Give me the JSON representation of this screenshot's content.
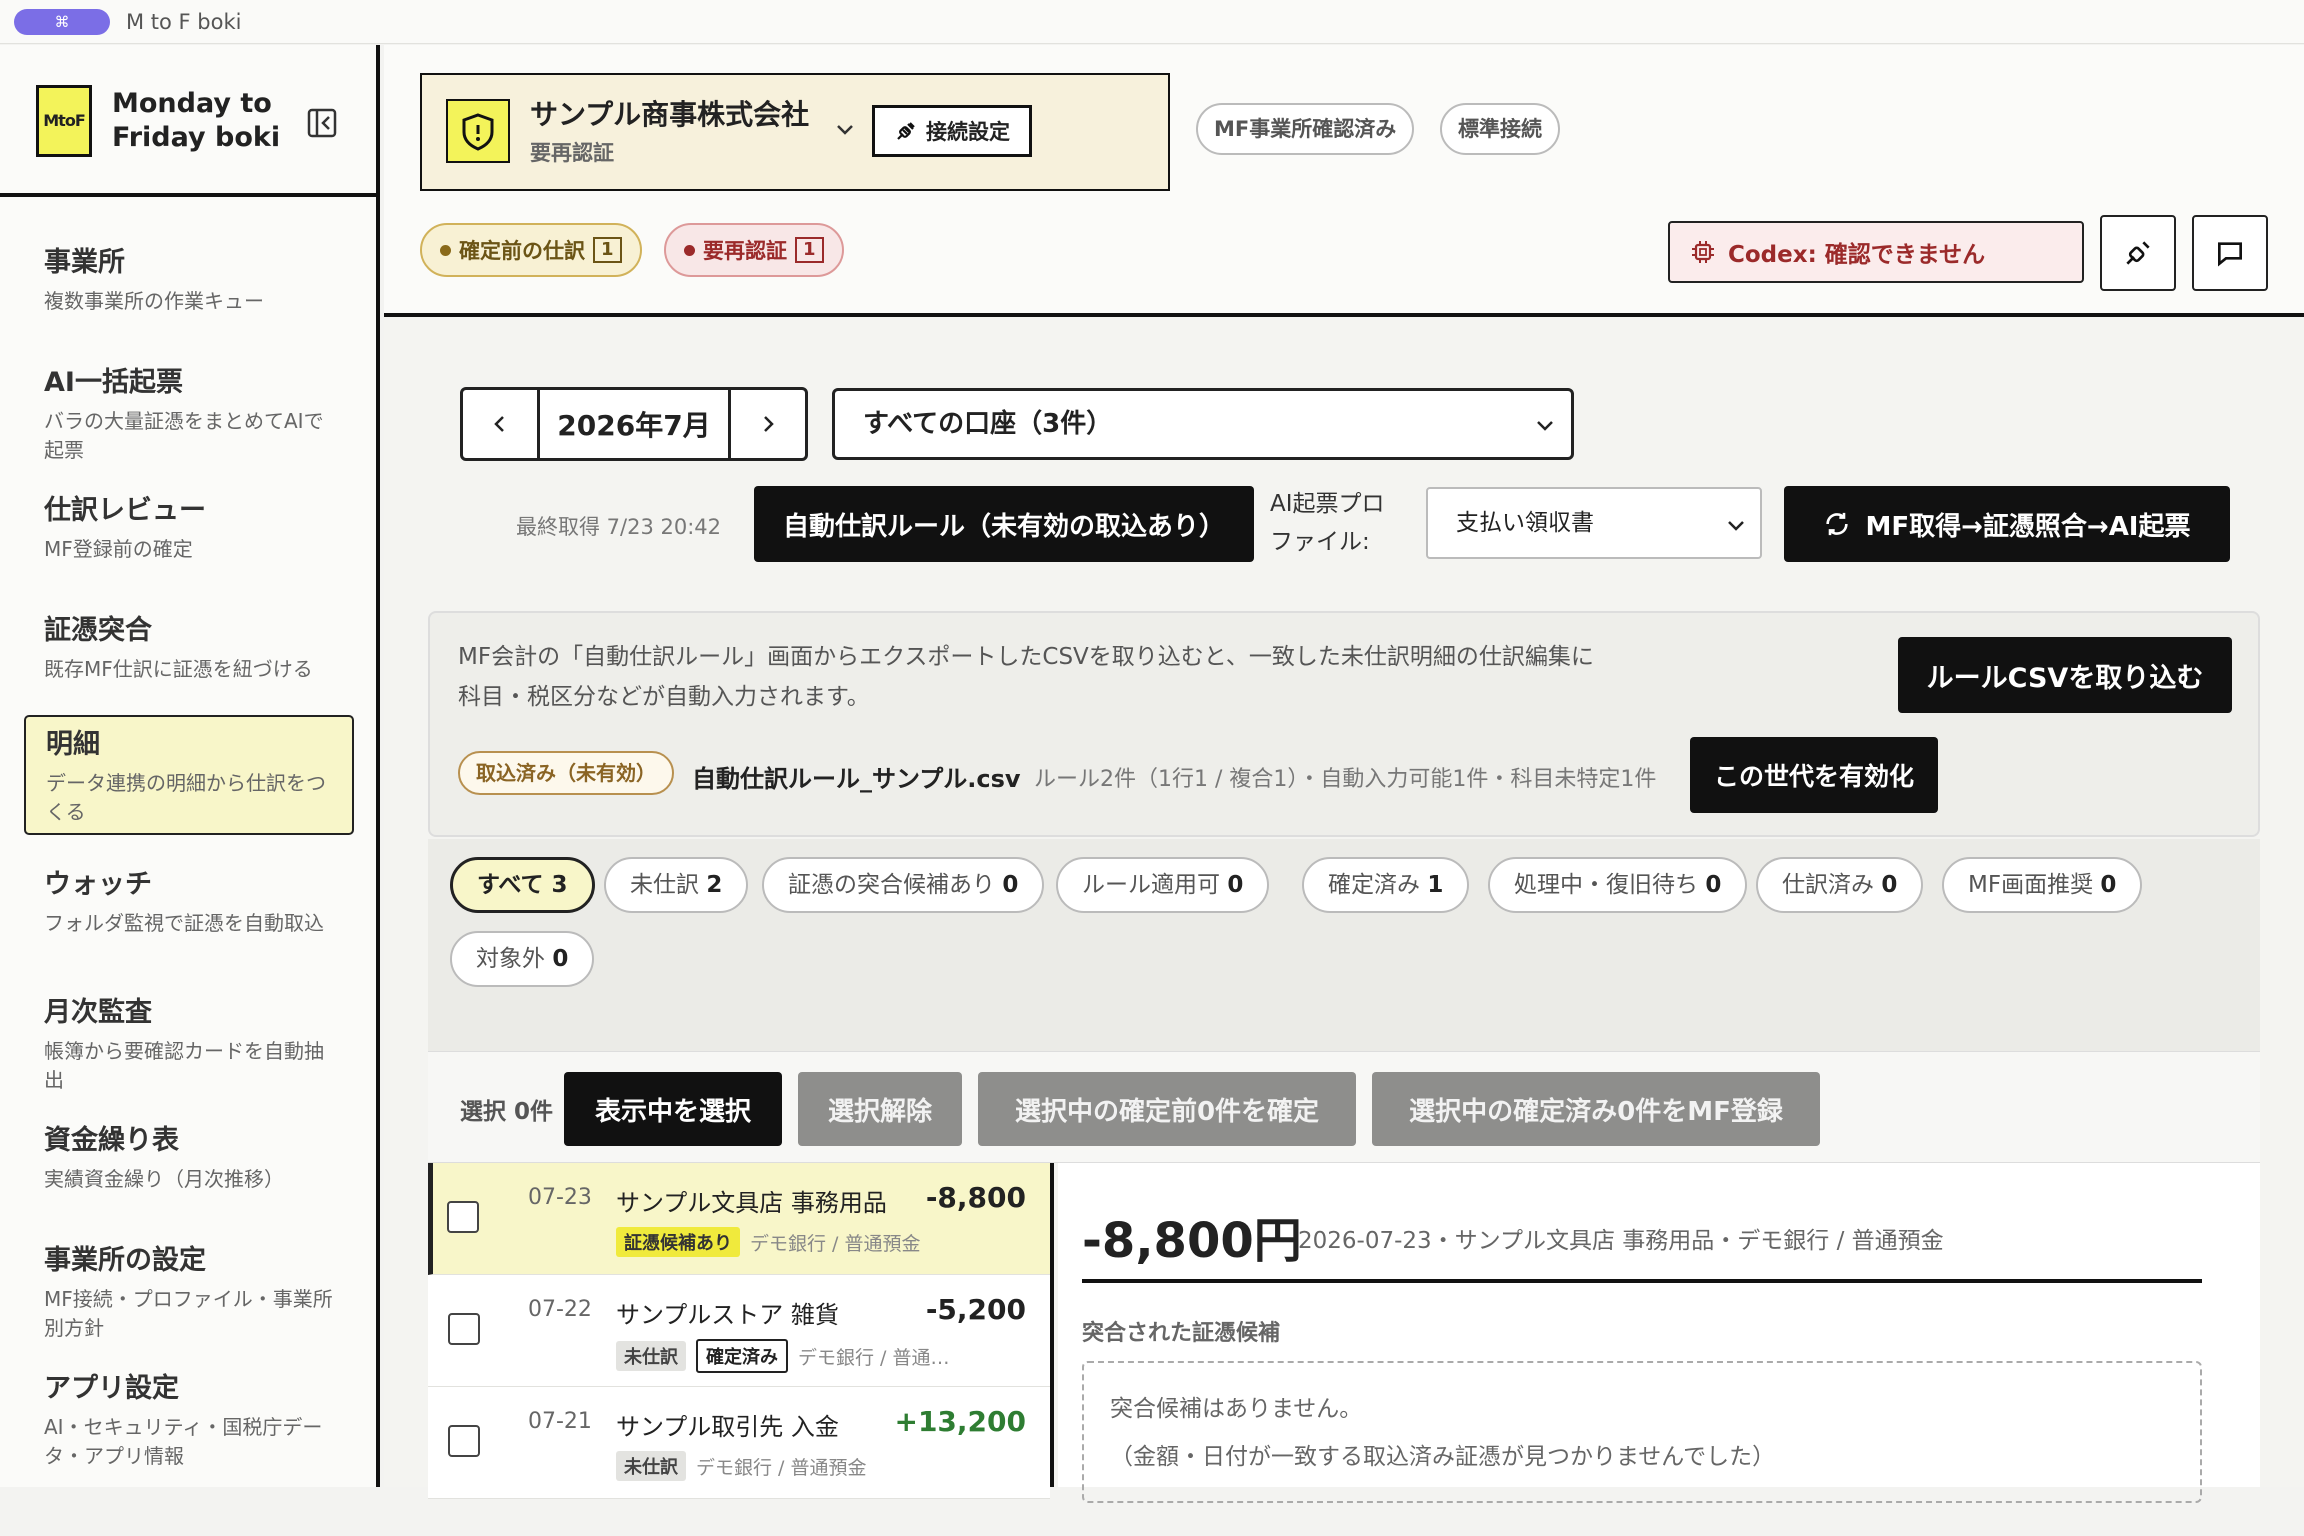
{
  "titlebar": {
    "shortcut_icon": "⌘",
    "app_title": "M to F boki"
  },
  "sidebar": {
    "logo_text": "MtoF",
    "brand_line1": "Monday to",
    "brand_line2": "Friday boki",
    "items": [
      {
        "title": "事業所",
        "sub": "複数事業所の作業キュー"
      },
      {
        "title": "AI一括起票",
        "sub": "バラの大量証憑をまとめてAIで起票"
      },
      {
        "title": "仕訳レビュー",
        "sub": "MF登録前の確定"
      },
      {
        "title": "証憑突合",
        "sub": "既存MF仕訳に証憑を紐づける"
      },
      {
        "title": "明細",
        "sub": "データ連携の明細から仕訳をつくる"
      },
      {
        "title": "ウォッチ",
        "sub": "フォルダ監視で証憑を自動取込"
      },
      {
        "title": "月次監査",
        "sub": "帳簿から要確認カードを自動抽出"
      },
      {
        "title": "資金繰り表",
        "sub": "実績資金繰り（月次推移）"
      },
      {
        "title": "事業所の設定",
        "sub": "MF接続・プロファイル・事業所別方針"
      },
      {
        "title": "アプリ設定",
        "sub": "AI・セキュリティ・国税庁データ・アプリ情報"
      }
    ]
  },
  "header": {
    "company_name": "サンプル商事株式会社",
    "company_status": "要再認証",
    "connection_button": "接続設定",
    "tags": [
      "MF事業所確認済み",
      "標準接続"
    ],
    "pending_label": "確定前の仕訳",
    "pending_count": "1",
    "reauth_label": "要再認証",
    "reauth_count": "1",
    "codex_status": "Codex: 確認できません"
  },
  "controls": {
    "month": "2026年7月",
    "account_select": "すべての口座（3件）",
    "last_fetch": "最終取得 7/23 20:42",
    "auto_rule_button": "自動仕訳ルール（未有効の取込あり）",
    "profile_label_line1": "AI起票プロ",
    "profile_label_line2": "ファイル:",
    "profile_value": "支払い領収書",
    "run_button": "MF取得→証憑照合→AI起票"
  },
  "rule_panel": {
    "description": "MF会計の「自動仕訳ルール」画面からエクスポートしたCSVを取り込むと、一致した未仕訳明細の仕訳編集に科目・税区分などが自動入力されます。",
    "import_button": "ルールCSVを取り込む",
    "imported_badge": "取込済み（未有効）",
    "file_name": "自動仕訳ルール_サンプル.csv",
    "summary": "ルール2件（1行1 / 複合1）・自動入力可能1件・科目未特定1件",
    "activate_button": "この世代を有効化"
  },
  "filters": [
    {
      "label": "すべて",
      "count": "3"
    },
    {
      "label": "未仕訳",
      "count": "2"
    },
    {
      "label": "証憑の突合候補あり",
      "count": "0"
    },
    {
      "label": "ルール適用可",
      "count": "0"
    },
    {
      "label": "確定済み",
      "count": "1"
    },
    {
      "label": "処理中・復旧待ち",
      "count": "0"
    },
    {
      "label": "仕訳済み",
      "count": "0"
    },
    {
      "label": "MF画面推奨",
      "count": "0"
    },
    {
      "label": "対象外",
      "count": "0"
    }
  ],
  "selection": {
    "count_label": "選択 0件",
    "select_visible": "表示中を選択",
    "clear": "選択解除",
    "confirm_pending": "選択中の確定前0件を確定",
    "register_mf": "選択中の確定済み0件をMF登録"
  },
  "transactions": [
    {
      "date": "07-23",
      "name": "サンプル文具店 事務用品",
      "amount": "-8,800",
      "tags": [
        "証憑候補あり"
      ],
      "account": "デモ銀行 / 普通預金"
    },
    {
      "date": "07-22",
      "name": "サンプルストア 雑貨",
      "amount": "-5,200",
      "tags": [
        "未仕訳",
        "確定済み"
      ],
      "account": "デモ銀行 / 普通…"
    },
    {
      "date": "07-21",
      "name": "サンプル取引先 入金",
      "amount": "+13,200",
      "tags": [
        "未仕訳"
      ],
      "account": "デモ銀行 / 普通預金"
    }
  ],
  "detail": {
    "amount": "-8,800円",
    "info": "2026-07-23・サンプル文具店 事務用品・デモ銀行 / 普通預金",
    "section_title": "突合された証憑候補",
    "empty_line1": "突合候補はありません。",
    "empty_line2": "（金額・日付が一致する取込済み証憑が見つかりませんでした）"
  },
  "colors": {
    "accent_yellow": "#f3f35a",
    "highlight": "#f8f6c9",
    "positive": "#2e7d32",
    "danger": "#9b2a2a"
  }
}
